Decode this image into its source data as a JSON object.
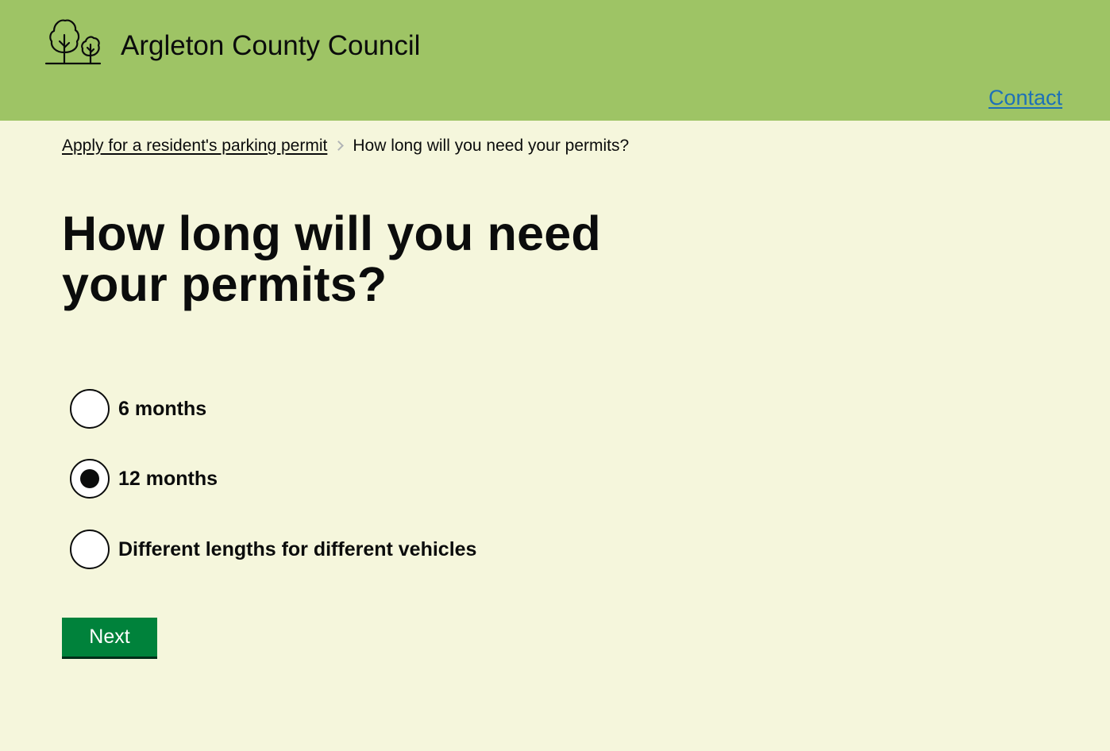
{
  "header": {
    "org_name": "Argleton County Council",
    "logo_icon": "trees-logo-icon",
    "contact_label": "Contact",
    "background_color": "#9ec465",
    "link_color": "#1d70b8"
  },
  "breadcrumb": {
    "parent_label": "Apply for a resident's parking permit",
    "separator_icon": "chevron-right-icon",
    "current_label": "How long will you need your permits?"
  },
  "main": {
    "title": "How long will you need your permits?",
    "options": [
      {
        "label": "6 months",
        "checked": false
      },
      {
        "label": "12 months",
        "checked": true
      },
      {
        "label": "Different lengths for different vehicles",
        "checked": false
      }
    ],
    "next_label": "Next",
    "button_color": "#00823b",
    "background_color": "#f5f6dc"
  }
}
